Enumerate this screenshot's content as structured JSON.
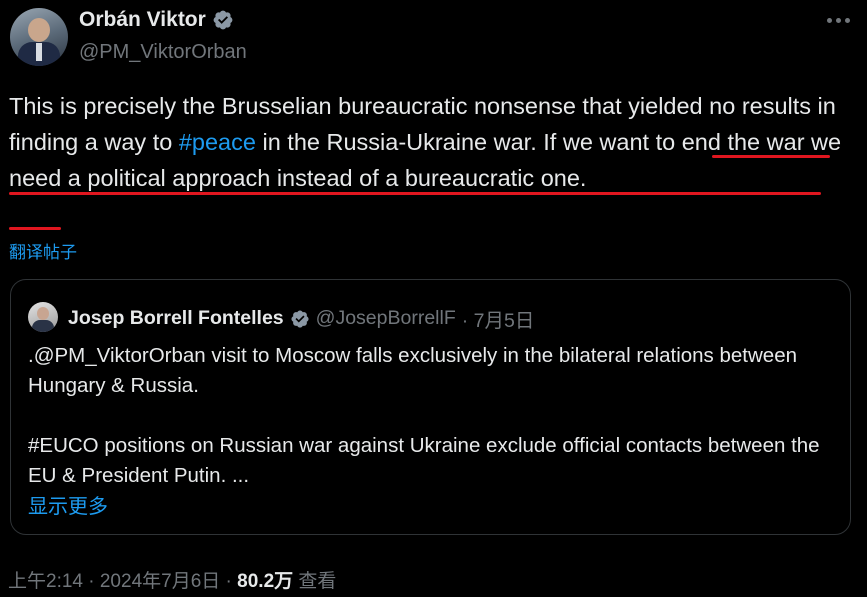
{
  "tweet": {
    "author_name": "Orbán Viktor",
    "author_handle": "@PM_ViktorOrban",
    "text_before_hashtag": "This is precisely the Brusselian bureaucratic nonsense that yielded no results in finding a way to ",
    "hashtag": "#peace",
    "text_after_hashtag": " in the Russia-Ukraine war. If we want to end the war we need a political approach instead of a bureaucratic one.",
    "translate_label": "翻译帖子",
    "timestamp": "上午2:14 · 2024年7月6日 · ",
    "views_count": "80.2万",
    "views_label": " 查看"
  },
  "quote": {
    "author_name": "Josep Borrell Fontelles",
    "author_handle": "@JosepBorrellF",
    "date": "· 7月5日",
    "paragraph_1": ".@PM_ViktorOrban visit to Moscow falls exclusively in the bilateral relations between Hungary & Russia.",
    "paragraph_2": "#EUCO positions on Russian war against Ukraine exclude official contacts between the EU & President Putin. ...",
    "show_more": "显示更多"
  },
  "colors": {
    "background": "#000000",
    "text": "#e7e9ea",
    "secondary": "#71767b",
    "link": "#1d9bf0",
    "underline": "#e0161f",
    "verified": "#1d9bf0"
  },
  "icons": [
    "verified-badge-icon",
    "more-options-icon"
  ]
}
